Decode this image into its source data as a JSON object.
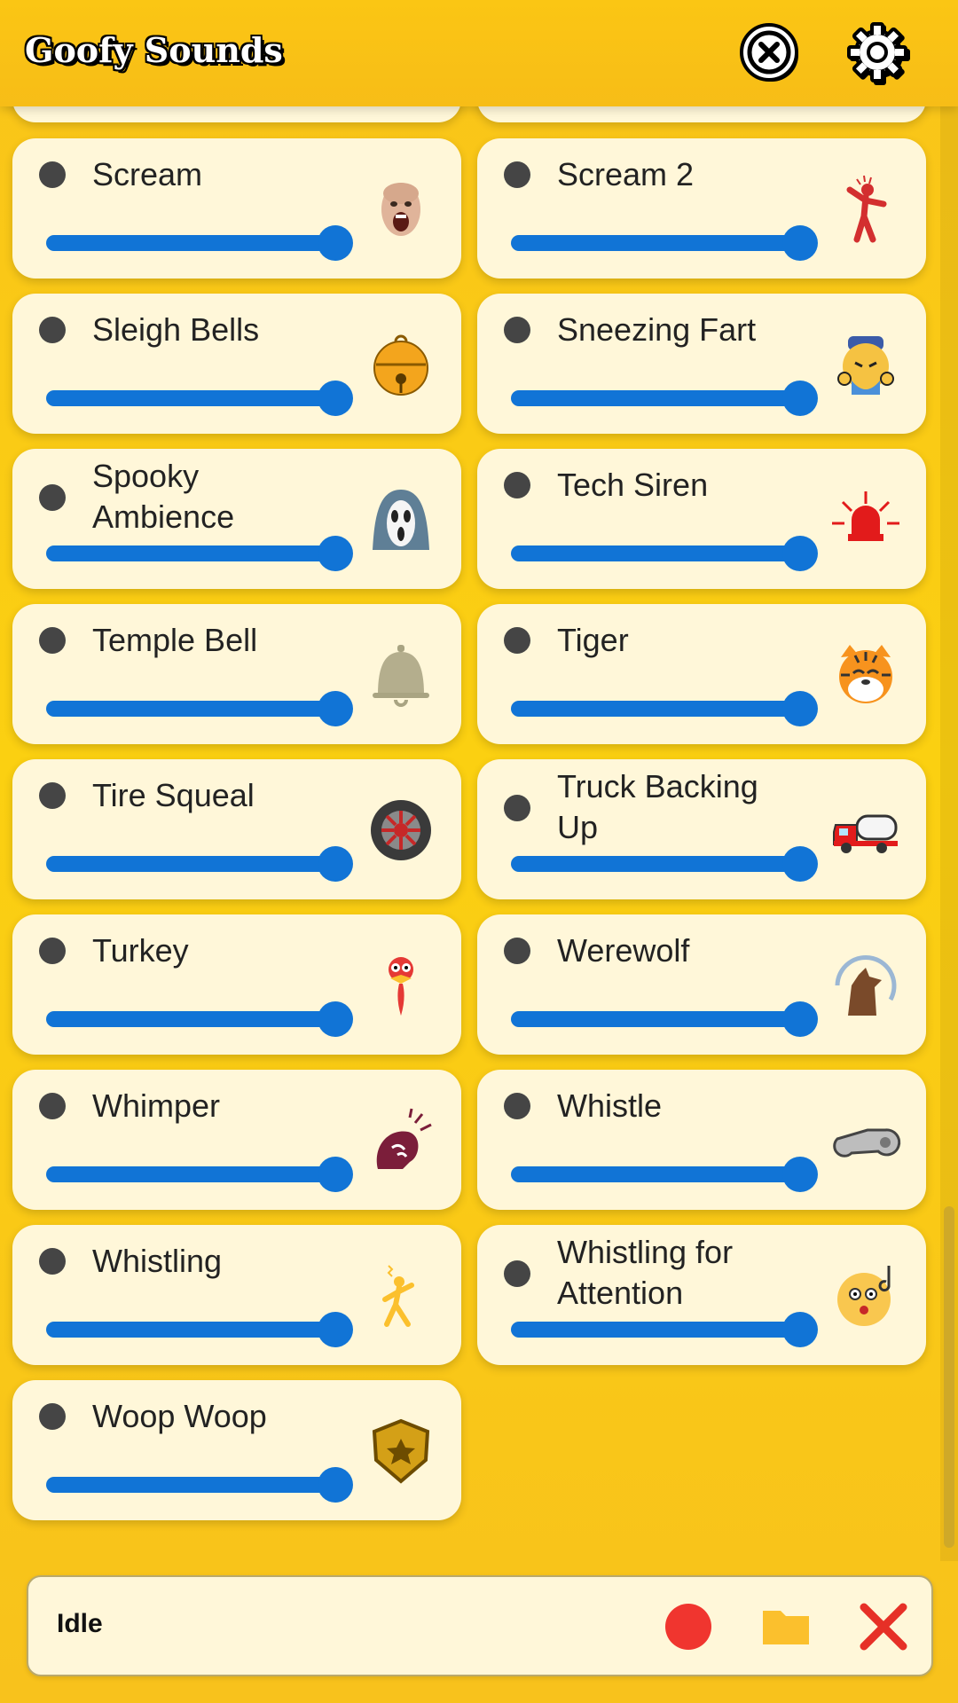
{
  "app": {
    "title": "Goofy Sounds"
  },
  "header": {
    "close_icon": "close-circle-icon",
    "settings_icon": "gear-icon"
  },
  "colors": {
    "background": "#f9c41a",
    "card": "#fff7d9",
    "slider": "#1174d6",
    "record": "#f0352f",
    "folder": "#fbc02d",
    "stop": "#e63027"
  },
  "sounds": [
    {
      "label": "Scream",
      "icon": "screaming-face-icon",
      "volume": 1.0
    },
    {
      "label": "Scream 2",
      "icon": "screaming-figure-icon",
      "volume": 1.0
    },
    {
      "label": "Sleigh Bells",
      "icon": "bell-icon",
      "volume": 1.0
    },
    {
      "label": "Sneezing Fart",
      "icon": "sneezing-face-icon",
      "volume": 1.0
    },
    {
      "label": "Spooky Ambience",
      "icon": "ghost-mask-icon",
      "volume": 1.0
    },
    {
      "label": "Tech Siren",
      "icon": "siren-icon",
      "volume": 1.0
    },
    {
      "label": "Temple Bell",
      "icon": "temple-bell-icon",
      "volume": 1.0
    },
    {
      "label": "Tiger",
      "icon": "tiger-icon",
      "volume": 1.0
    },
    {
      "label": "Tire Squeal",
      "icon": "tire-icon",
      "volume": 1.0
    },
    {
      "label": "Truck Backing Up",
      "icon": "truck-icon",
      "volume": 1.0
    },
    {
      "label": "Turkey",
      "icon": "turkey-icon",
      "volume": 1.0
    },
    {
      "label": "Werewolf",
      "icon": "werewolf-icon",
      "volume": 1.0
    },
    {
      "label": "Whimper",
      "icon": "whimper-icon",
      "volume": 1.0
    },
    {
      "label": "Whistle",
      "icon": "whistle-icon",
      "volume": 1.0
    },
    {
      "label": "Whistling",
      "icon": "whistling-person-icon",
      "volume": 1.0
    },
    {
      "label": "Whistling for Attention",
      "icon": "whistling-face-icon",
      "volume": 1.0
    },
    {
      "label": "Woop Woop",
      "icon": "police-badge-icon",
      "volume": 1.0
    }
  ],
  "bottom_bar": {
    "status": "Idle",
    "record_icon": "record-icon",
    "folder_icon": "folder-icon",
    "stop_icon": "close-x-icon"
  }
}
